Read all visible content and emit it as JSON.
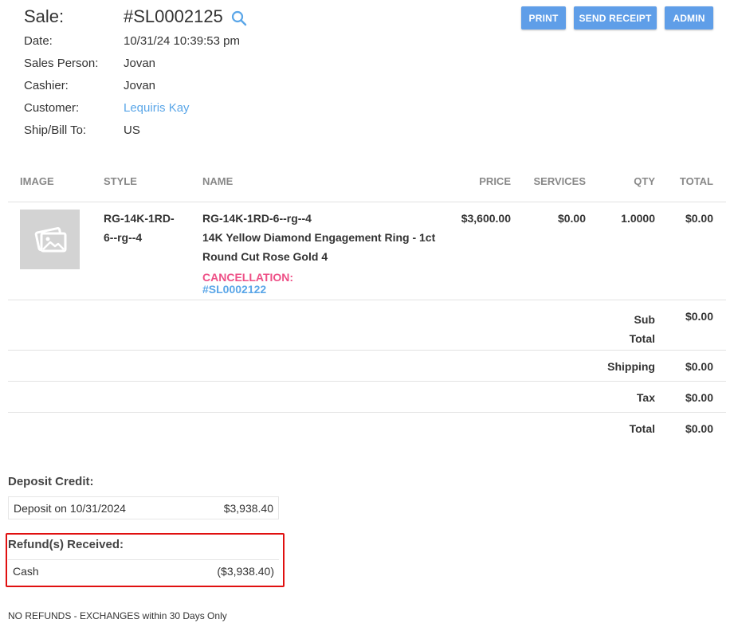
{
  "header": {
    "sale_label": "Sale:",
    "sale_number": "#SL0002125",
    "fields": [
      {
        "label": "Date:",
        "value": "10/31/24 10:39:53 pm"
      },
      {
        "label": "Sales Person:",
        "value": "Jovan"
      },
      {
        "label": "Cashier:",
        "value": "Jovan"
      },
      {
        "label": "Customer:",
        "value": "Lequiris Kay"
      },
      {
        "label": "Ship/Bill To:",
        "value": "US"
      }
    ]
  },
  "actions": {
    "print": "PRINT",
    "send_receipt": "SEND RECEIPT",
    "admin": "ADMIN"
  },
  "table": {
    "columns": [
      "IMAGE",
      "STYLE",
      "NAME",
      "PRICE",
      "SERVICES",
      "QTY",
      "TOTAL"
    ],
    "rows": [
      {
        "style_line1": "RG-14K-1RD-",
        "style_line2": "6--rg--4",
        "name_code": "RG-14K-1RD-6--rg--4",
        "name_line1": "14K Yellow Diamond Engagement Ring - 1ct",
        "name_line2": "Round Cut Rose Gold 4",
        "cancellation_label": "CANCELLATION:",
        "cancellation_ref": "#SL0002122",
        "price": "$3,600.00",
        "services": "$0.00",
        "qty": "1.0000",
        "total": "$0.00"
      }
    ]
  },
  "summary": {
    "sub_label_1": "Sub",
    "sub_label_2": "Total",
    "sub_value": "$0.00",
    "shipping_label": "Shipping",
    "shipping_value": "$0.00",
    "tax_label": "Tax",
    "tax_value": "$0.00",
    "total_label": "Total",
    "total_value": "$0.00"
  },
  "deposit": {
    "title": "Deposit Credit:",
    "entries": [
      {
        "label": "Deposit on 10/31/2024",
        "amount": "$3,938.40"
      }
    ]
  },
  "refunds": {
    "title": "Refund(s) Received:",
    "entries": [
      {
        "label": "Cash",
        "amount": "($3,938.40)"
      }
    ]
  },
  "footer": {
    "note": "NO REFUNDS - EXCHANGES within 30 Days Only"
  },
  "colors": {
    "accent": "#5f9ee8",
    "link": "#5aa6e8",
    "cancel": "#ee4f86",
    "highlight": "#e01010"
  },
  "icons": {
    "search": "search-icon",
    "image_placeholder": "image-placeholder-icon"
  }
}
